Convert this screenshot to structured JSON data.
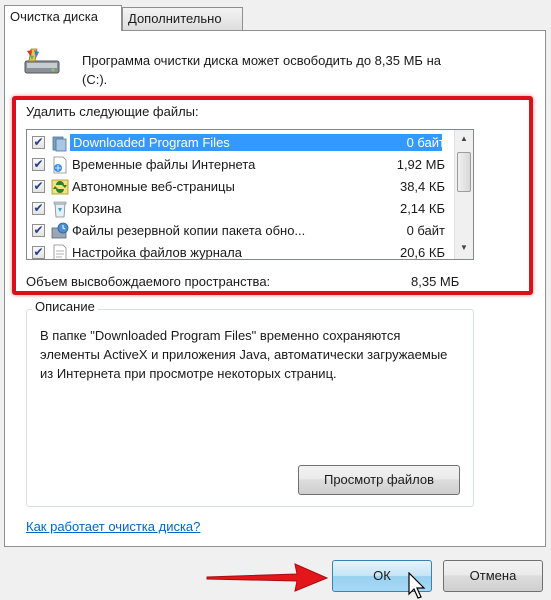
{
  "tabs": [
    {
      "label": "Очистка диска",
      "active": true
    },
    {
      "label": "Дополнительно",
      "active": false
    }
  ],
  "header": {
    "icon": "disk-cleanup-icon",
    "text": "Программа очистки диска может освободить до 8,35 МБ на  (C:)."
  },
  "files": {
    "label": "Удалить следующие файлы:",
    "items": [
      {
        "name": "Downloaded Program Files",
        "size": "0 байт",
        "checked": true,
        "selected": true,
        "icon": "folder-icon"
      },
      {
        "name": "Временные файлы Интернета",
        "size": "1,92 МБ",
        "checked": true,
        "selected": false,
        "icon": "internet-files-icon"
      },
      {
        "name": "Автономные веб-страницы",
        "size": "38,4 КБ",
        "checked": true,
        "selected": false,
        "icon": "offline-pages-icon"
      },
      {
        "name": "Корзина",
        "size": "2,14 КБ",
        "checked": true,
        "selected": false,
        "icon": "recycle-bin-icon"
      },
      {
        "name": "Файлы резервной копии пакета обно...",
        "size": "0 байт",
        "checked": true,
        "selected": false,
        "icon": "backup-files-icon"
      },
      {
        "name": "Настройка файлов журнала",
        "size": "20,6 КБ",
        "checked": true,
        "selected": false,
        "icon": "log-files-icon"
      }
    ]
  },
  "free_space": {
    "label": "Объем высвобождаемого пространства:",
    "value": "8,35 МБ"
  },
  "description": {
    "title": "Описание",
    "text": "В папке \"Downloaded Program Files\" временно сохраняются элементы ActiveX и приложения Java, автоматически загружаемые из Интернета при просмотре некоторых страниц.",
    "view_files_label": "Просмотр файлов"
  },
  "help_link": "Как работает очистка диска?",
  "buttons": {
    "ok": "ОК",
    "cancel": "Отмена"
  },
  "colors": {
    "highlight_border": "#d9121a",
    "selection": "#3399ff",
    "link": "#0066cc"
  }
}
